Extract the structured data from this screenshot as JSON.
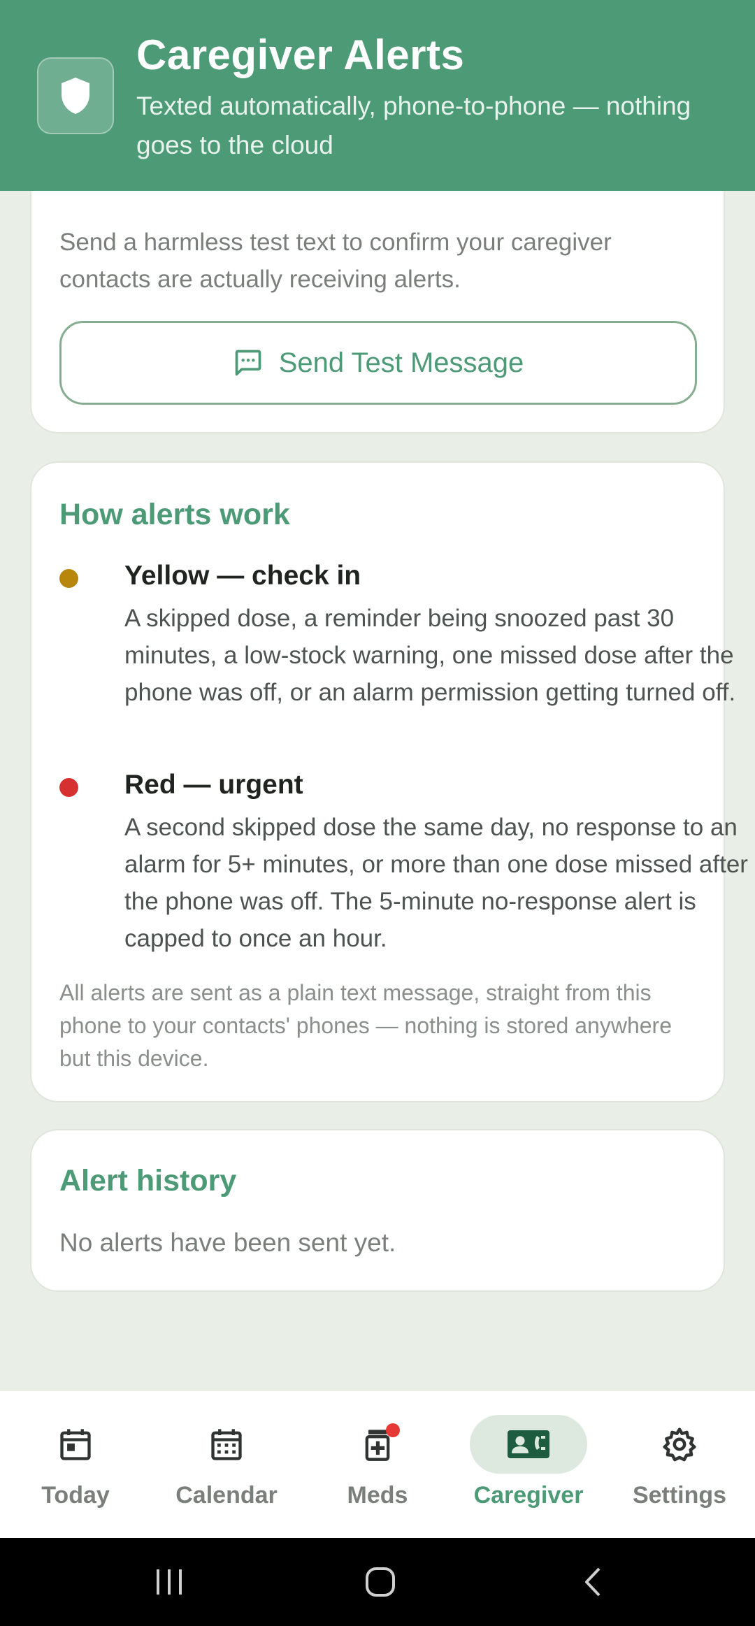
{
  "header": {
    "title": "Caregiver Alerts",
    "subtitle": "Texted automatically, phone-to-phone — nothing goes to the cloud",
    "icon": "shield-icon"
  },
  "test_card": {
    "description": "Send a harmless test text to confirm your caregiver contacts are actually receiving alerts.",
    "button_label": "Send Test Message",
    "button_icon": "message-icon"
  },
  "how_card": {
    "title": "How alerts work",
    "yellow": {
      "heading": "Yellow — check in",
      "body": "A skipped dose, a reminder being snoozed past 30 minutes, a low-stock warning, one missed dose after the phone was off, or an alarm permission getting turned off.",
      "color": "#b8860b"
    },
    "red": {
      "heading": "Red — urgent",
      "body": "A second skipped dose the same day, no response to an alarm for 5+ minutes, or more than one dose missed after the phone was off. The 5-minute no-response alert is capped to once an hour.",
      "color": "#d63031"
    },
    "footnote": "All alerts are sent as a plain text message, straight from this phone to your contacts' phones — nothing is stored anywhere but this device."
  },
  "history_card": {
    "title": "Alert history",
    "empty_text": "No alerts have been sent yet."
  },
  "nav": {
    "items": [
      {
        "label": "Today",
        "icon": "calendar-today-icon",
        "active": false
      },
      {
        "label": "Calendar",
        "icon": "calendar-month-icon",
        "active": false
      },
      {
        "label": "Meds",
        "icon": "medication-icon",
        "active": false,
        "badge": true
      },
      {
        "label": "Caregiver",
        "icon": "contact-phone-icon",
        "active": true
      },
      {
        "label": "Settings",
        "icon": "gear-icon",
        "active": false
      }
    ]
  },
  "colors": {
    "brand": "#4c9a76",
    "background": "#e9efe6",
    "active_pill": "#dde8de"
  }
}
